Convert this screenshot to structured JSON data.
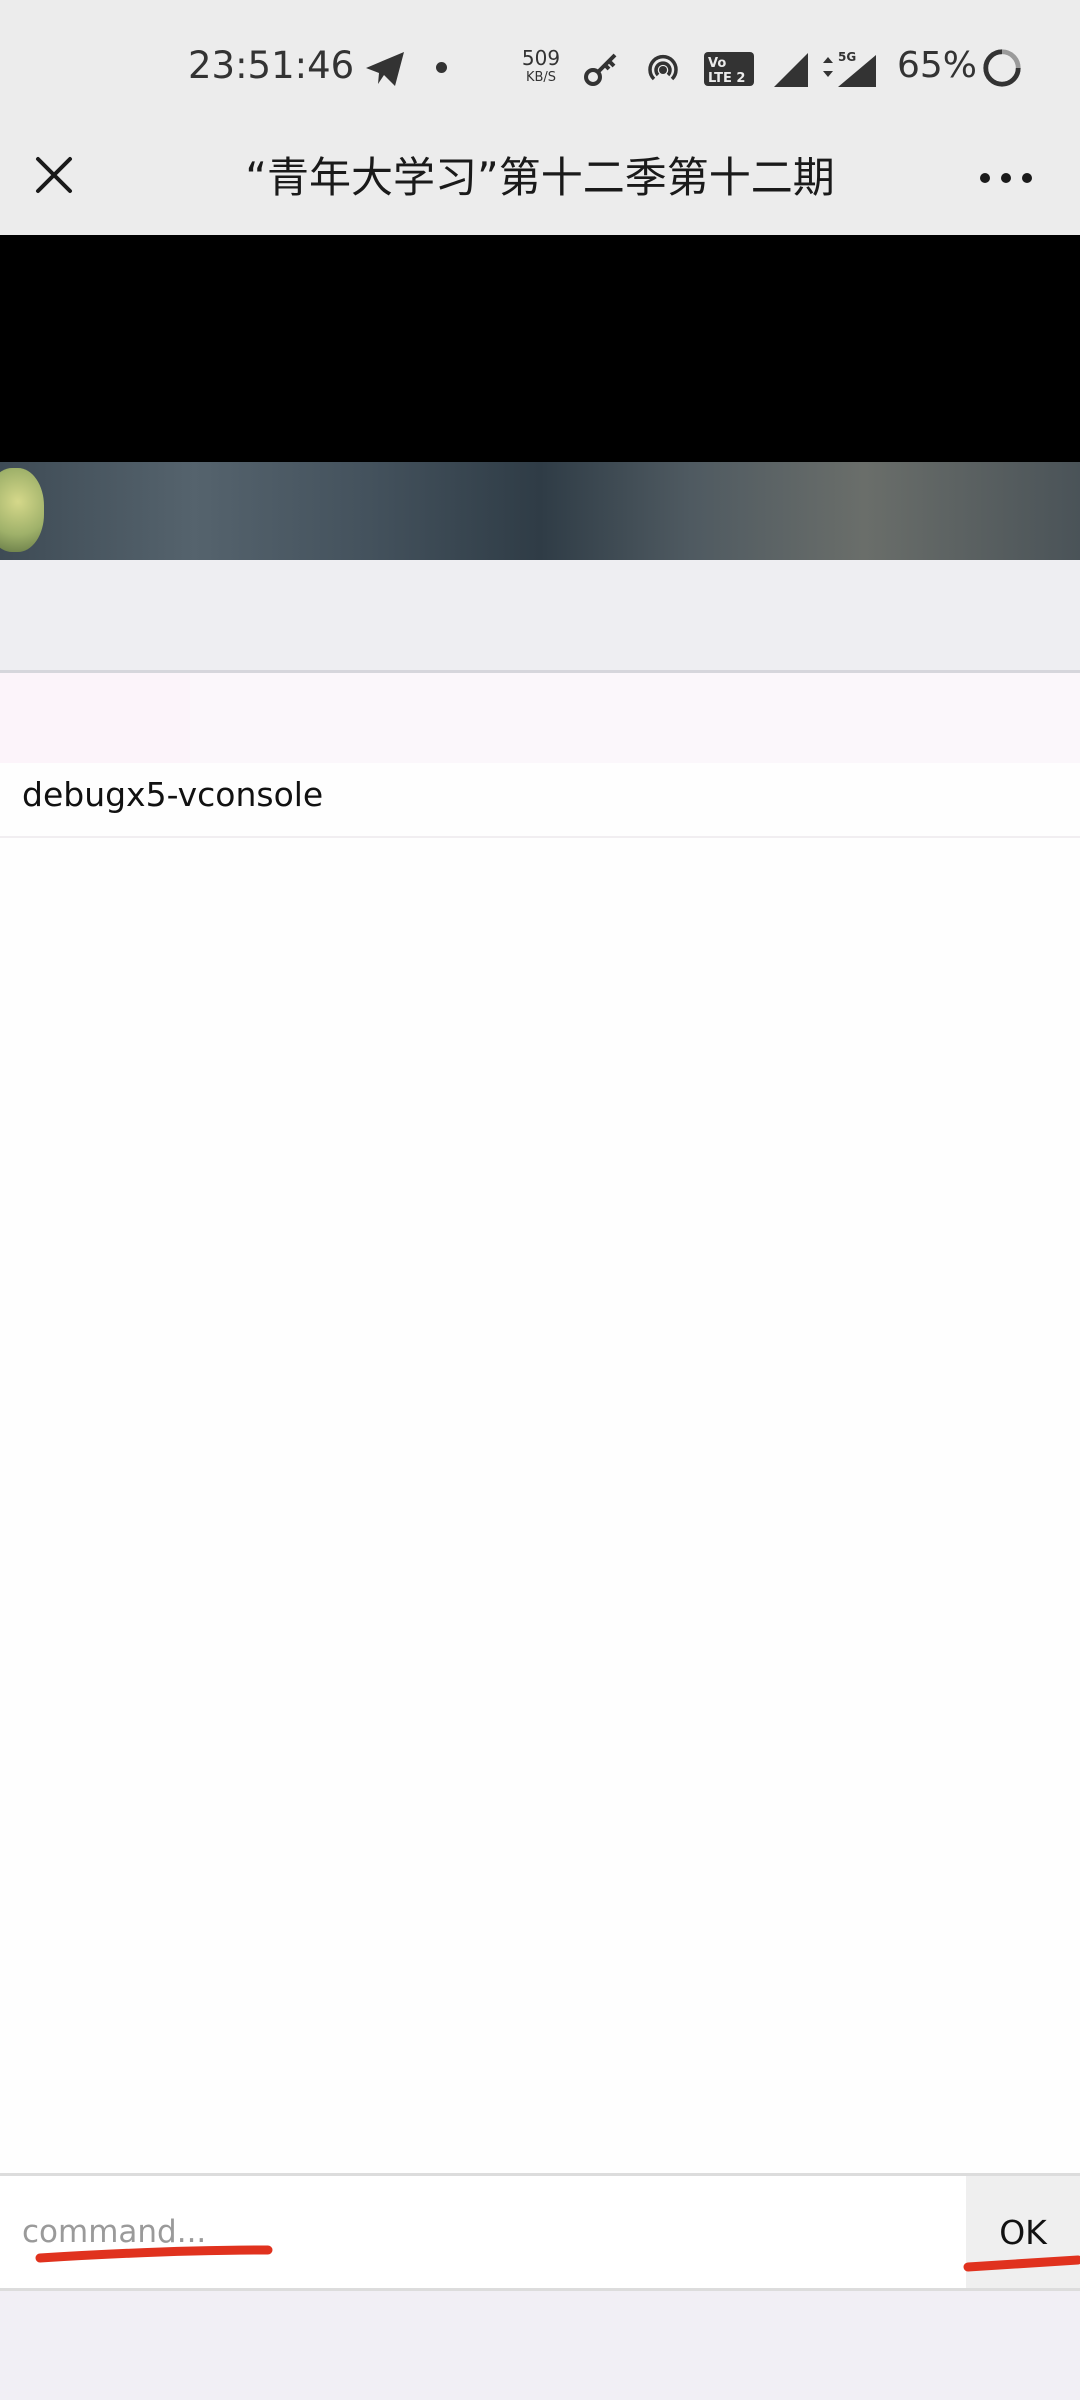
{
  "status_bar": {
    "time": "23:51:46",
    "net_speed_value": "509",
    "net_speed_unit": "KB/S",
    "battery": "65%",
    "icons": [
      "telegram-icon",
      "dot-icon",
      "key-icon",
      "hotspot-icon",
      "volte-lte2-icon",
      "signal-icon",
      "5g-signal-icon",
      "battery-ring-icon"
    ]
  },
  "titlebar": {
    "title": "“青年大学习”第十二季第十二期",
    "close_icon": "close-icon",
    "more_icon": "more-icon"
  },
  "vconsole": {
    "log_lines": [
      "debugx5-vconsole"
    ],
    "command_placeholder": "command...",
    "ok_label": "OK"
  },
  "annotation_color": "#e0321e"
}
